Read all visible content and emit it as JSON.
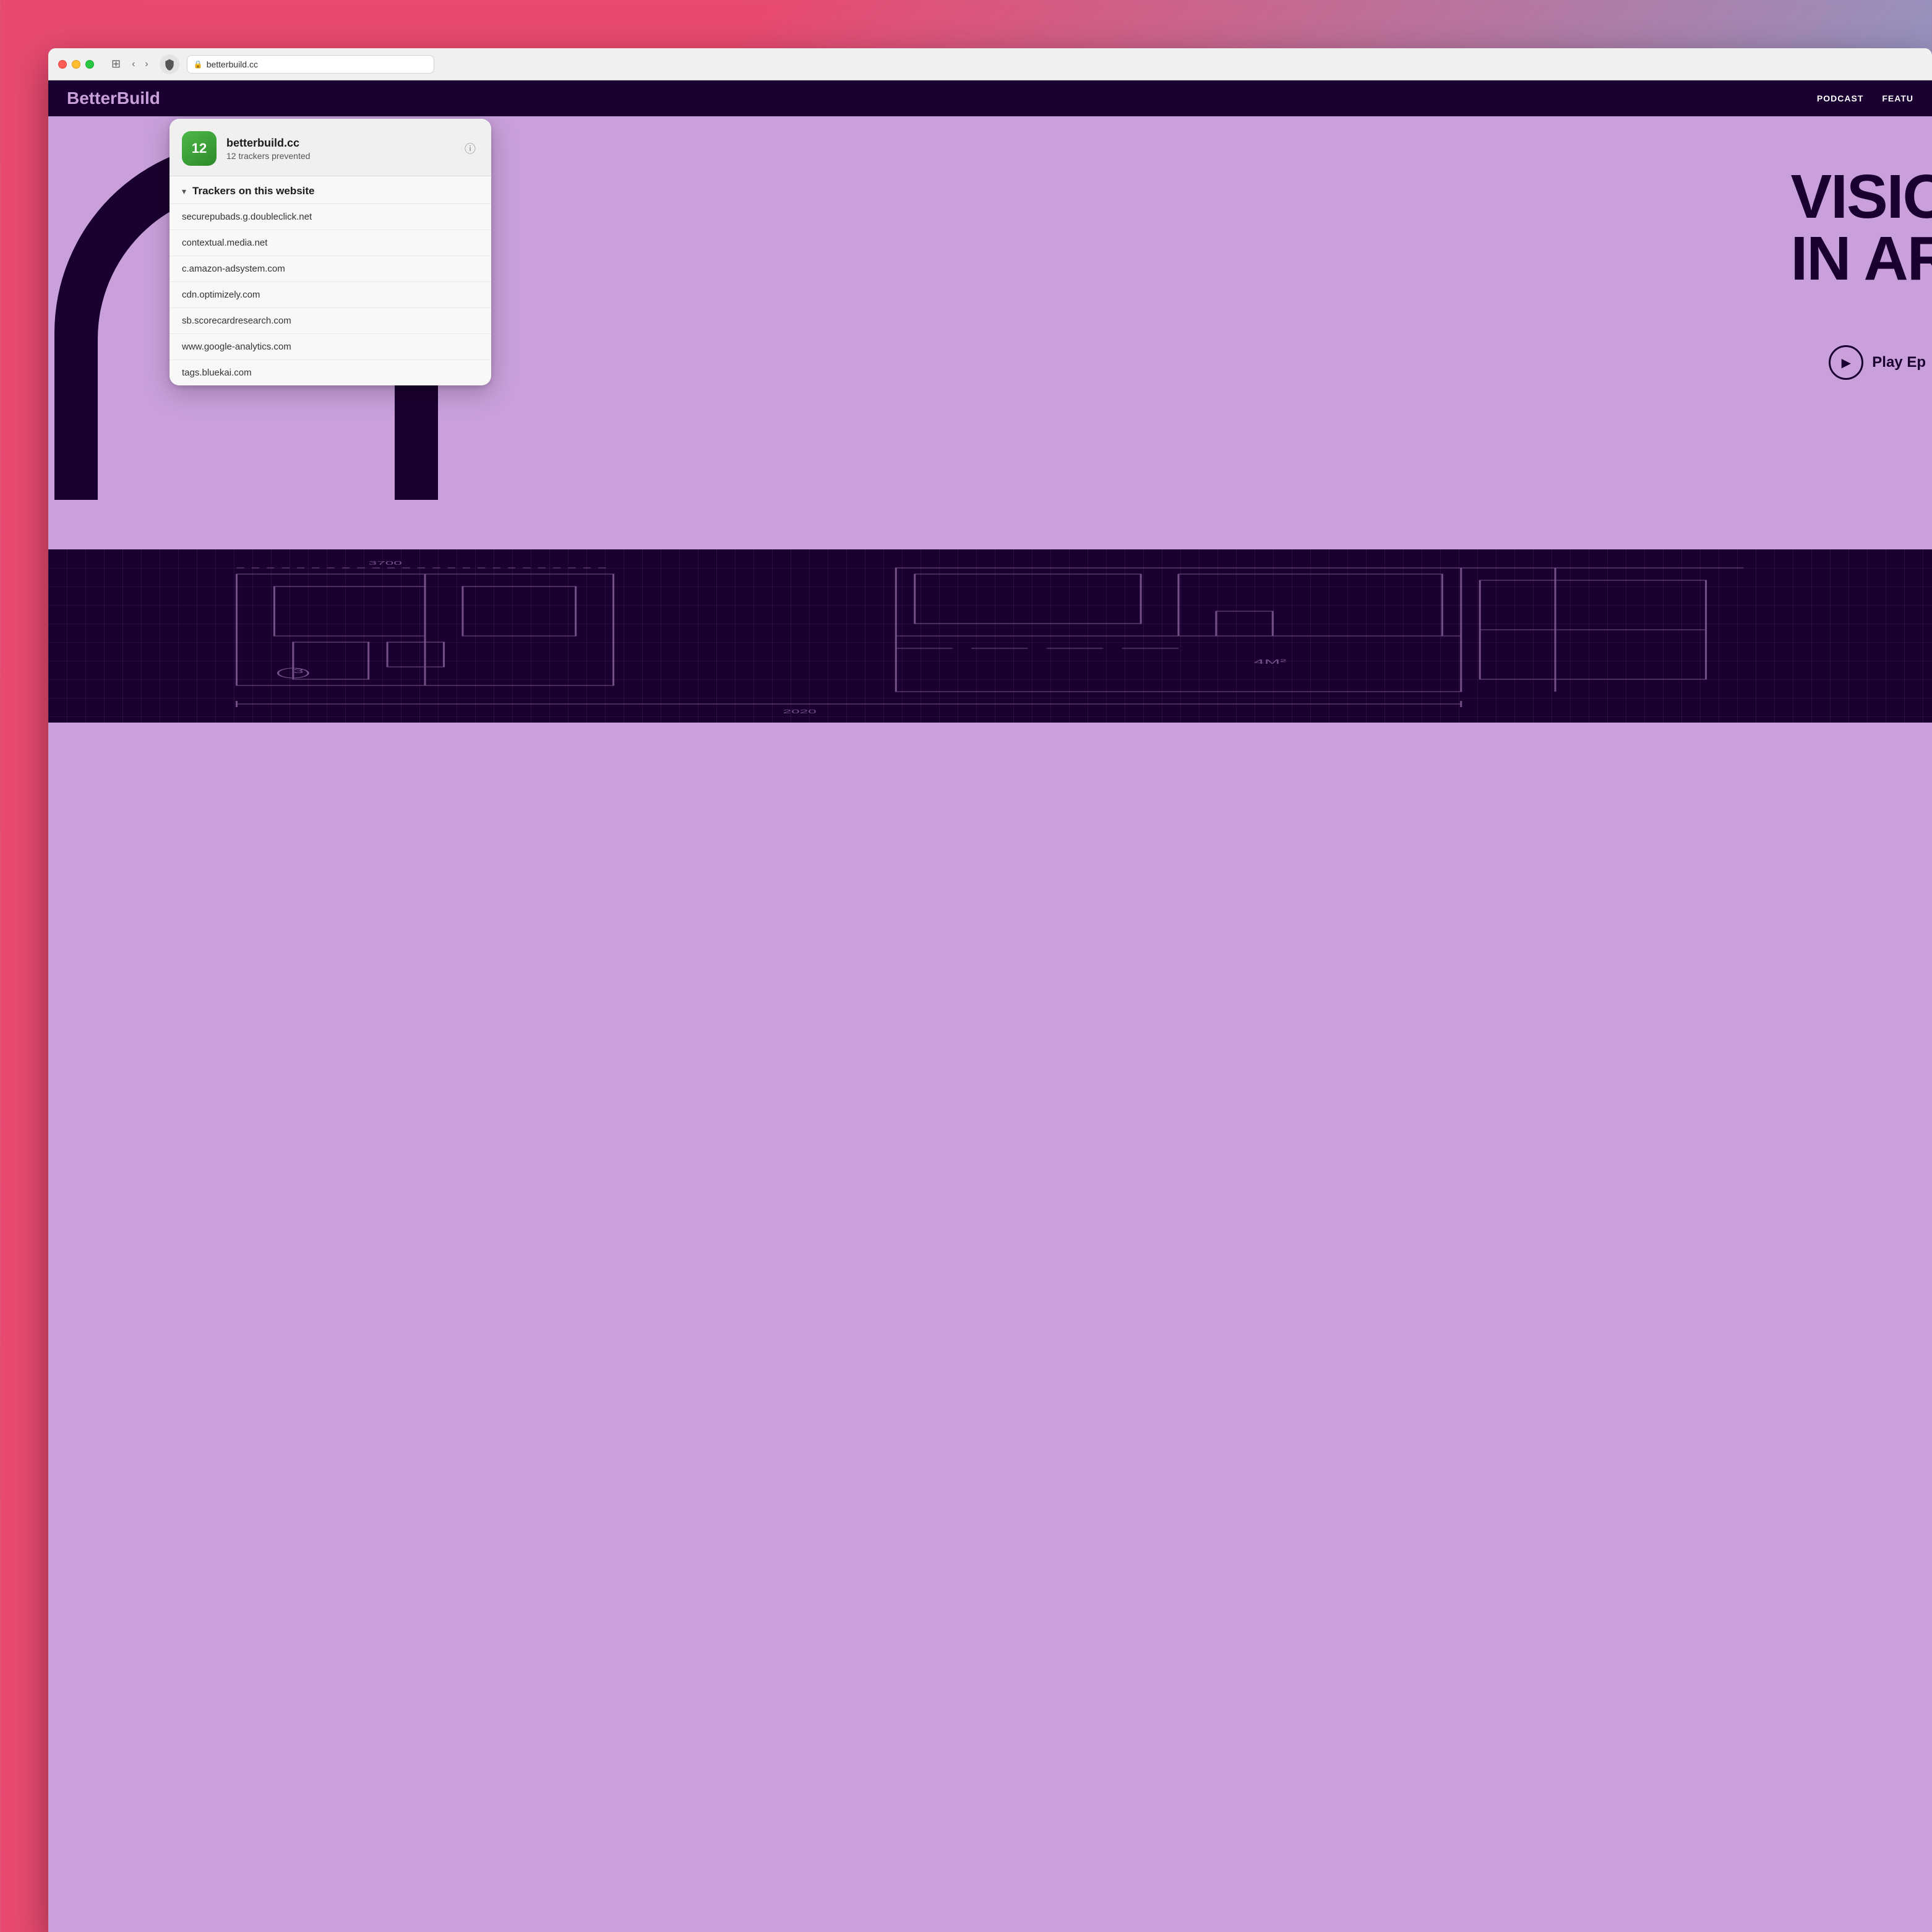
{
  "window": {
    "url": "betterbuild.cc"
  },
  "navbar": {
    "back_label": "‹",
    "forward_label": "›",
    "sidebar_label": "⊞"
  },
  "popup": {
    "site_name": "betterbuild.cc",
    "trackers_count": "12 trackers prevented",
    "badge_number": "12",
    "info_button_label": "ⓘ",
    "section_title": "Trackers on this website",
    "trackers": [
      {
        "domain": "securepubads.g.doubleclick.net"
      },
      {
        "domain": "contextual.media.net"
      },
      {
        "domain": "c.amazon-adsystem.com"
      },
      {
        "domain": "cdn.optimizely.com"
      },
      {
        "domain": "sb.scorecardresearch.com"
      },
      {
        "domain": "www.google-analytics.com"
      },
      {
        "domain": "tags.bluekai.com"
      }
    ]
  },
  "website": {
    "logo_text_black": "BetterBu",
    "logo_text_purple": "ild",
    "nav_items": [
      "PODCAST",
      "FEATU"
    ],
    "hero_text_line1": "VISIO",
    "hero_text_line2": "IN AR",
    "play_label": "Play Ep"
  }
}
